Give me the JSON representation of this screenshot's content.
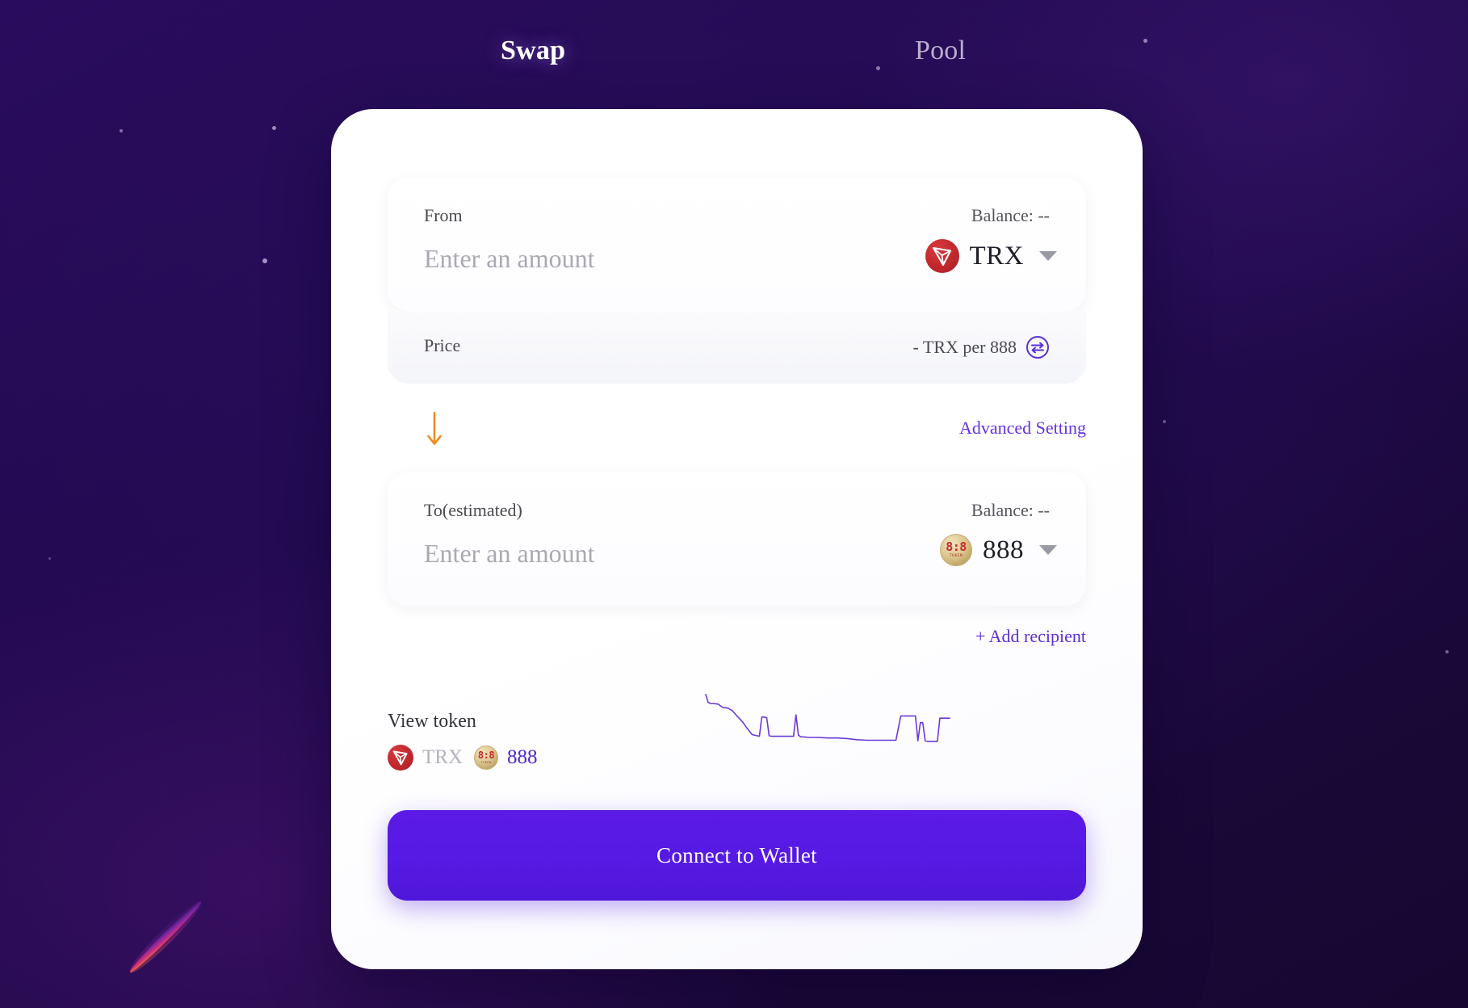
{
  "theme": {
    "bg_top": "#2a0c5e",
    "bg_bottom": "#160730",
    "card_bg": "#ffffff",
    "accent_purple": "#5c1ae6",
    "link_purple": "#6433e0",
    "arrow_orange": "#f08a1e",
    "trx_red": "#c0282c",
    "coin_gold": "#dcc68e"
  },
  "tabs": [
    {
      "label": "Swap",
      "active": true
    },
    {
      "label": "Pool",
      "active": false
    }
  ],
  "from": {
    "label": "From",
    "balance": "Balance: --",
    "amount_value": "",
    "amount_placeholder": "Enter an amount",
    "token": "TRX",
    "token_icon": "trx-coin-icon",
    "caret_icon": "chevron-down-icon"
  },
  "price": {
    "label": "Price",
    "value": "- TRX per 888",
    "swap_icon": "exchange-arrows-icon"
  },
  "advanced": {
    "down_arrow_icon": "arrow-down-icon",
    "link_label": "Advanced Setting"
  },
  "to": {
    "label": "To(estimated)",
    "balance": "Balance: --",
    "amount_value": "",
    "amount_placeholder": "Enter an amount",
    "token": "888",
    "token_icon": "coin-888-icon",
    "caret_icon": "chevron-down-icon"
  },
  "add_recipient": {
    "label": "+ Add recipient"
  },
  "view_token": {
    "title": "View token",
    "tokens": [
      {
        "label": "TRX",
        "icon": "trx-coin-icon",
        "active": false
      },
      {
        "label": "888",
        "icon": "coin-888-icon",
        "active": true
      }
    ]
  },
  "action": {
    "connect_label": "Connect to Wallet"
  },
  "chart_data": {
    "type": "line",
    "title": "",
    "xlabel": "",
    "ylabel": "",
    "grid": false,
    "legend": "none",
    "stroke_color": "#6a3ad6",
    "xlim": [
      0,
      100
    ],
    "ylim": [
      0,
      100
    ],
    "x": [
      0,
      1,
      2,
      3,
      5,
      7,
      9,
      11,
      13,
      15,
      17,
      19,
      21,
      22,
      23,
      24,
      25,
      26,
      27,
      28,
      30,
      32,
      34,
      36,
      37,
      38,
      39,
      40,
      42,
      46,
      50,
      54,
      58,
      62,
      66,
      70,
      74,
      78,
      80,
      81,
      82,
      84,
      86,
      87,
      88,
      89,
      90,
      91,
      92,
      93,
      94,
      95,
      96,
      98,
      100
    ],
    "y": [
      96,
      82,
      80,
      80,
      79,
      73,
      72,
      67,
      57,
      48,
      36,
      25,
      23,
      22,
      56,
      56,
      55,
      23,
      22,
      22,
      22,
      22,
      22,
      22,
      60,
      24,
      21,
      21,
      20,
      20,
      19,
      19,
      18,
      16,
      15,
      15,
      15,
      15,
      58,
      58,
      58,
      58,
      58,
      14,
      46,
      46,
      14,
      13,
      13,
      13,
      13,
      13,
      54,
      54,
      54
    ]
  }
}
